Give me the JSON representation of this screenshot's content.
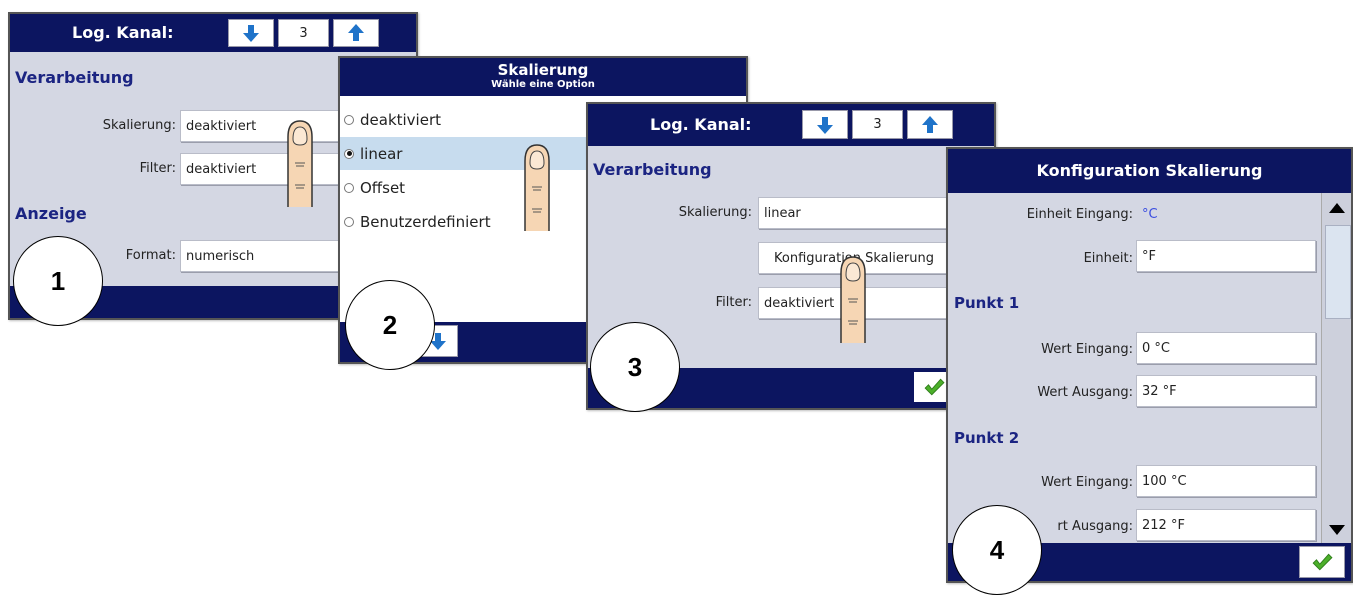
{
  "screen1": {
    "title": "Log. Kanal:",
    "channel": "3",
    "section_processing": "Verarbeitung",
    "label_scaling": "Skalierung:",
    "value_scaling": "deaktiviert",
    "label_filter": "Filter:",
    "value_filter": "deaktiviert",
    "section_display": "Anzeige",
    "label_format": "Format:",
    "value_format": "numerisch",
    "step": "1"
  },
  "screen2": {
    "title": "Skalierung",
    "subtitle": "Wähle eine Option",
    "options": [
      "deaktiviert",
      "linear",
      "Offset",
      "Benutzerdefiniert"
    ],
    "selected": "linear",
    "step": "2"
  },
  "screen3": {
    "title": "Log. Kanal:",
    "channel": "3",
    "section_processing": "Verarbeitung",
    "label_scaling": "Skalierung:",
    "value_scaling": "linear",
    "config_button": "Konfiguration Skalierung",
    "label_filter": "Filter:",
    "value_filter": "deaktiviert",
    "step": "3"
  },
  "screen4": {
    "title": "Konfiguration Skalierung",
    "label_unit_in": "Einheit Eingang:",
    "value_unit_in": "°C",
    "label_unit": "Einheit:",
    "value_unit": "°F",
    "section_p1": "Punkt 1",
    "label_in1": "Wert Eingang:",
    "value_in1": "0 °C",
    "label_out1": "Wert Ausgang:",
    "value_out1": "32 °F",
    "section_p2": "Punkt 2",
    "label_in2": "Wert Eingang:",
    "value_in2": "100 °C",
    "label_out2_visible": "rt Ausgang:",
    "value_out2": "212 °F",
    "step": "4"
  },
  "colors": {
    "titlebar": "#0c1560",
    "panel": "#d4d7e3",
    "section_text": "#1b2482",
    "arrow_blue": "#1f73c9",
    "highlight": "#c7dcee",
    "ok_green": "#4caf2a"
  },
  "icons": {
    "down": "arrow-down-icon",
    "up": "arrow-up-icon",
    "ok": "checkmark-icon",
    "finger": "pointing-finger-icon"
  }
}
